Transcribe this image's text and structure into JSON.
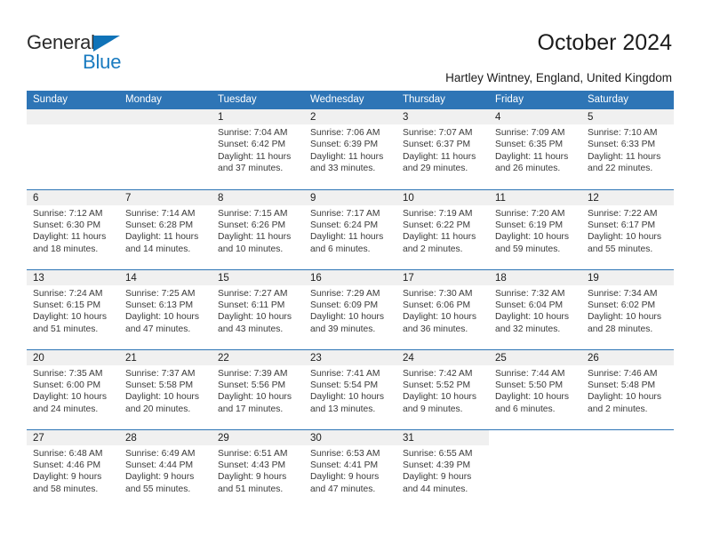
{
  "brand": {
    "name_part1": "General",
    "name_part2": "Blue",
    "accent_color": "#1a7bc0",
    "header_color": "#2e75b6",
    "triangle_icon": "triangle-logo-icon"
  },
  "header": {
    "title": "October 2024",
    "location": "Hartley Wintney, England, United Kingdom"
  },
  "calendar": {
    "weekday_headers": [
      "Sunday",
      "Monday",
      "Tuesday",
      "Wednesday",
      "Thursday",
      "Friday",
      "Saturday"
    ],
    "labels": {
      "sunrise": "Sunrise:",
      "sunset": "Sunset:",
      "daylight": "Daylight:"
    },
    "weeks": [
      [
        {
          "day": "",
          "sunrise": "",
          "sunset": "",
          "daylight_line1": "",
          "daylight_line2": ""
        },
        {
          "day": "",
          "sunrise": "",
          "sunset": "",
          "daylight_line1": "",
          "daylight_line2": ""
        },
        {
          "day": "1",
          "sunrise": "Sunrise: 7:04 AM",
          "sunset": "Sunset: 6:42 PM",
          "daylight_line1": "Daylight: 11 hours",
          "daylight_line2": "and 37 minutes."
        },
        {
          "day": "2",
          "sunrise": "Sunrise: 7:06 AM",
          "sunset": "Sunset: 6:39 PM",
          "daylight_line1": "Daylight: 11 hours",
          "daylight_line2": "and 33 minutes."
        },
        {
          "day": "3",
          "sunrise": "Sunrise: 7:07 AM",
          "sunset": "Sunset: 6:37 PM",
          "daylight_line1": "Daylight: 11 hours",
          "daylight_line2": "and 29 minutes."
        },
        {
          "day": "4",
          "sunrise": "Sunrise: 7:09 AM",
          "sunset": "Sunset: 6:35 PM",
          "daylight_line1": "Daylight: 11 hours",
          "daylight_line2": "and 26 minutes."
        },
        {
          "day": "5",
          "sunrise": "Sunrise: 7:10 AM",
          "sunset": "Sunset: 6:33 PM",
          "daylight_line1": "Daylight: 11 hours",
          "daylight_line2": "and 22 minutes."
        }
      ],
      [
        {
          "day": "6",
          "sunrise": "Sunrise: 7:12 AM",
          "sunset": "Sunset: 6:30 PM",
          "daylight_line1": "Daylight: 11 hours",
          "daylight_line2": "and 18 minutes."
        },
        {
          "day": "7",
          "sunrise": "Sunrise: 7:14 AM",
          "sunset": "Sunset: 6:28 PM",
          "daylight_line1": "Daylight: 11 hours",
          "daylight_line2": "and 14 minutes."
        },
        {
          "day": "8",
          "sunrise": "Sunrise: 7:15 AM",
          "sunset": "Sunset: 6:26 PM",
          "daylight_line1": "Daylight: 11 hours",
          "daylight_line2": "and 10 minutes."
        },
        {
          "day": "9",
          "sunrise": "Sunrise: 7:17 AM",
          "sunset": "Sunset: 6:24 PM",
          "daylight_line1": "Daylight: 11 hours",
          "daylight_line2": "and 6 minutes."
        },
        {
          "day": "10",
          "sunrise": "Sunrise: 7:19 AM",
          "sunset": "Sunset: 6:22 PM",
          "daylight_line1": "Daylight: 11 hours",
          "daylight_line2": "and 2 minutes."
        },
        {
          "day": "11",
          "sunrise": "Sunrise: 7:20 AM",
          "sunset": "Sunset: 6:19 PM",
          "daylight_line1": "Daylight: 10 hours",
          "daylight_line2": "and 59 minutes."
        },
        {
          "day": "12",
          "sunrise": "Sunrise: 7:22 AM",
          "sunset": "Sunset: 6:17 PM",
          "daylight_line1": "Daylight: 10 hours",
          "daylight_line2": "and 55 minutes."
        }
      ],
      [
        {
          "day": "13",
          "sunrise": "Sunrise: 7:24 AM",
          "sunset": "Sunset: 6:15 PM",
          "daylight_line1": "Daylight: 10 hours",
          "daylight_line2": "and 51 minutes."
        },
        {
          "day": "14",
          "sunrise": "Sunrise: 7:25 AM",
          "sunset": "Sunset: 6:13 PM",
          "daylight_line1": "Daylight: 10 hours",
          "daylight_line2": "and 47 minutes."
        },
        {
          "day": "15",
          "sunrise": "Sunrise: 7:27 AM",
          "sunset": "Sunset: 6:11 PM",
          "daylight_line1": "Daylight: 10 hours",
          "daylight_line2": "and 43 minutes."
        },
        {
          "day": "16",
          "sunrise": "Sunrise: 7:29 AM",
          "sunset": "Sunset: 6:09 PM",
          "daylight_line1": "Daylight: 10 hours",
          "daylight_line2": "and 39 minutes."
        },
        {
          "day": "17",
          "sunrise": "Sunrise: 7:30 AM",
          "sunset": "Sunset: 6:06 PM",
          "daylight_line1": "Daylight: 10 hours",
          "daylight_line2": "and 36 minutes."
        },
        {
          "day": "18",
          "sunrise": "Sunrise: 7:32 AM",
          "sunset": "Sunset: 6:04 PM",
          "daylight_line1": "Daylight: 10 hours",
          "daylight_line2": "and 32 minutes."
        },
        {
          "day": "19",
          "sunrise": "Sunrise: 7:34 AM",
          "sunset": "Sunset: 6:02 PM",
          "daylight_line1": "Daylight: 10 hours",
          "daylight_line2": "and 28 minutes."
        }
      ],
      [
        {
          "day": "20",
          "sunrise": "Sunrise: 7:35 AM",
          "sunset": "Sunset: 6:00 PM",
          "daylight_line1": "Daylight: 10 hours",
          "daylight_line2": "and 24 minutes."
        },
        {
          "day": "21",
          "sunrise": "Sunrise: 7:37 AM",
          "sunset": "Sunset: 5:58 PM",
          "daylight_line1": "Daylight: 10 hours",
          "daylight_line2": "and 20 minutes."
        },
        {
          "day": "22",
          "sunrise": "Sunrise: 7:39 AM",
          "sunset": "Sunset: 5:56 PM",
          "daylight_line1": "Daylight: 10 hours",
          "daylight_line2": "and 17 minutes."
        },
        {
          "day": "23",
          "sunrise": "Sunrise: 7:41 AM",
          "sunset": "Sunset: 5:54 PM",
          "daylight_line1": "Daylight: 10 hours",
          "daylight_line2": "and 13 minutes."
        },
        {
          "day": "24",
          "sunrise": "Sunrise: 7:42 AM",
          "sunset": "Sunset: 5:52 PM",
          "daylight_line1": "Daylight: 10 hours",
          "daylight_line2": "and 9 minutes."
        },
        {
          "day": "25",
          "sunrise": "Sunrise: 7:44 AM",
          "sunset": "Sunset: 5:50 PM",
          "daylight_line1": "Daylight: 10 hours",
          "daylight_line2": "and 6 minutes."
        },
        {
          "day": "26",
          "sunrise": "Sunrise: 7:46 AM",
          "sunset": "Sunset: 5:48 PM",
          "daylight_line1": "Daylight: 10 hours",
          "daylight_line2": "and 2 minutes."
        }
      ],
      [
        {
          "day": "27",
          "sunrise": "Sunrise: 6:48 AM",
          "sunset": "Sunset: 4:46 PM",
          "daylight_line1": "Daylight: 9 hours",
          "daylight_line2": "and 58 minutes."
        },
        {
          "day": "28",
          "sunrise": "Sunrise: 6:49 AM",
          "sunset": "Sunset: 4:44 PM",
          "daylight_line1": "Daylight: 9 hours",
          "daylight_line2": "and 55 minutes."
        },
        {
          "day": "29",
          "sunrise": "Sunrise: 6:51 AM",
          "sunset": "Sunset: 4:43 PM",
          "daylight_line1": "Daylight: 9 hours",
          "daylight_line2": "and 51 minutes."
        },
        {
          "day": "30",
          "sunrise": "Sunrise: 6:53 AM",
          "sunset": "Sunset: 4:41 PM",
          "daylight_line1": "Daylight: 9 hours",
          "daylight_line2": "and 47 minutes."
        },
        {
          "day": "31",
          "sunrise": "Sunrise: 6:55 AM",
          "sunset": "Sunset: 4:39 PM",
          "daylight_line1": "Daylight: 9 hours",
          "daylight_line2": "and 44 minutes."
        },
        {
          "day": "",
          "sunrise": "",
          "sunset": "",
          "daylight_line1": "",
          "daylight_line2": ""
        },
        {
          "day": "",
          "sunrise": "",
          "sunset": "",
          "daylight_line1": "",
          "daylight_line2": ""
        }
      ]
    ]
  }
}
